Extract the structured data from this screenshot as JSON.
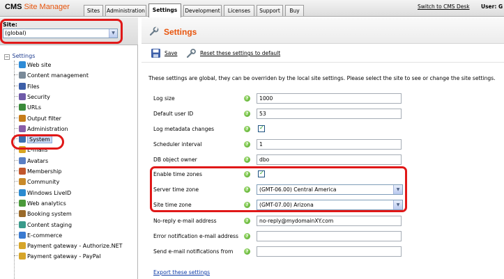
{
  "header": {
    "logo_part1": "CMS",
    "logo_part2": "Site Manager",
    "tabs": [
      {
        "label": "Sites"
      },
      {
        "label": "Administration"
      },
      {
        "label": "Settings"
      },
      {
        "label": "Development"
      },
      {
        "label": "Licenses"
      },
      {
        "label": "Support"
      },
      {
        "label": "Buy"
      }
    ],
    "switch_link": "Switch to CMS Desk",
    "user_label": "User: G"
  },
  "site_selector": {
    "label": "Site:",
    "value": "(global)"
  },
  "tree": {
    "root": "Settings",
    "items": [
      {
        "label": "Web site",
        "icon": "globe-icon"
      },
      {
        "label": "Content management",
        "icon": "pencil-doc-icon"
      },
      {
        "label": "Files",
        "icon": "floppy-icon"
      },
      {
        "label": "Security",
        "icon": "security-icon"
      },
      {
        "label": "URLs",
        "icon": "url-icon"
      },
      {
        "label": "Output filter",
        "icon": "filter-icon"
      },
      {
        "label": "Administration",
        "icon": "admin-icon"
      },
      {
        "label": "System",
        "icon": "computer-icon"
      },
      {
        "label": "E-mails",
        "icon": "email-icon"
      },
      {
        "label": "Avatars",
        "icon": "avatar-icon"
      },
      {
        "label": "Membership",
        "icon": "membership-icon"
      },
      {
        "label": "Community",
        "icon": "community-icon"
      },
      {
        "label": "Windows LiveID",
        "icon": "liveid-icon"
      },
      {
        "label": "Web analytics",
        "icon": "analytics-icon"
      },
      {
        "label": "Booking system",
        "icon": "booking-icon"
      },
      {
        "label": "Content staging",
        "icon": "staging-icon"
      },
      {
        "label": "E-commerce",
        "icon": "ecommerce-icon"
      },
      {
        "label": "Payment gateway - Authorize.NET",
        "icon": "payment-icon"
      },
      {
        "label": "Payment gateway - PayPal",
        "icon": "payment-icon"
      }
    ]
  },
  "main": {
    "title": "Settings",
    "save_label": "Save",
    "reset_label": "Reset these settings to default",
    "info_text": "These settings are global, they can be overriden by the local site settings. Please select the site to see or change the site settings.",
    "fields": [
      {
        "label": "Log size",
        "value": "1000"
      },
      {
        "label": "Default user ID",
        "value": "53"
      },
      {
        "label": "Log metadata changes",
        "checked": "✓"
      },
      {
        "label": "Scheduler interval",
        "value": "1"
      },
      {
        "label": "DB object owner",
        "value": "dbo"
      },
      {
        "label": "Enable time zones",
        "checked": "✓"
      },
      {
        "label": "Server time zone",
        "value": "(GMT-06.00) Central America"
      },
      {
        "label": "Site time zone",
        "value": "(GMT-07.00) Arizona"
      },
      {
        "label": "No-reply e-mail address",
        "value": "no-reply@mydomainXY.com"
      },
      {
        "label": "Error notification e-mail address",
        "value": ""
      },
      {
        "label": "Send e-mail notifications from",
        "value": ""
      }
    ],
    "export_link": "Export these settings"
  },
  "colors": {
    "accent": "#e8540c",
    "highlight": "#e01818",
    "help": "#4ea521",
    "link": "#0b3aa6"
  }
}
